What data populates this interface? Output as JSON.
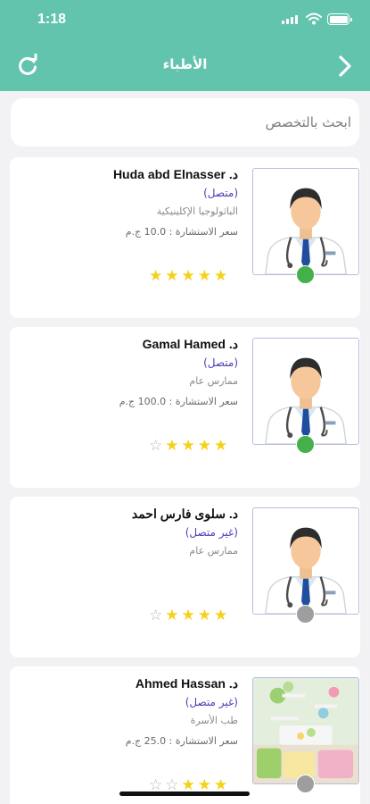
{
  "status_bar": {
    "time": "1:18"
  },
  "header": {
    "title": "الأطباء"
  },
  "search": {
    "placeholder": "ابحث بالتخصص"
  },
  "colors": {
    "header": "#63c4ad",
    "online": "#43b04a",
    "offline": "#9e9e9e",
    "star": "#f4d11a",
    "state_text": "#4a3fb8"
  },
  "doctors": [
    {
      "name": "د. Huda abd Elnasser",
      "state": "(متصل)",
      "online": true,
      "specialty": "الباثولوجيا الإكلينيكية",
      "price": "سعر الاستشارة  : 10.0 ج.م",
      "rating": 5,
      "photo": "doctor-avatar"
    },
    {
      "name": "د. Gamal Hamed",
      "state": "(متصل)",
      "online": true,
      "specialty": "ممارس عام",
      "price": "سعر الاستشارة  : 100.0 ج.م",
      "rating": 4,
      "photo": "doctor-avatar"
    },
    {
      "name": "د. سلوى فارس احمد",
      "state": "(غير متصل)",
      "online": false,
      "specialty": "ممارس عام",
      "price": "",
      "rating": 4,
      "photo": "doctor-avatar"
    },
    {
      "name": "د. Ahmed Hassan",
      "state": "(غير متصل)",
      "online": false,
      "specialty": "طب الأسرة",
      "price": "سعر الاستشارة  : 25.0 ج.م",
      "rating": 3,
      "photo": "room-photo"
    }
  ]
}
